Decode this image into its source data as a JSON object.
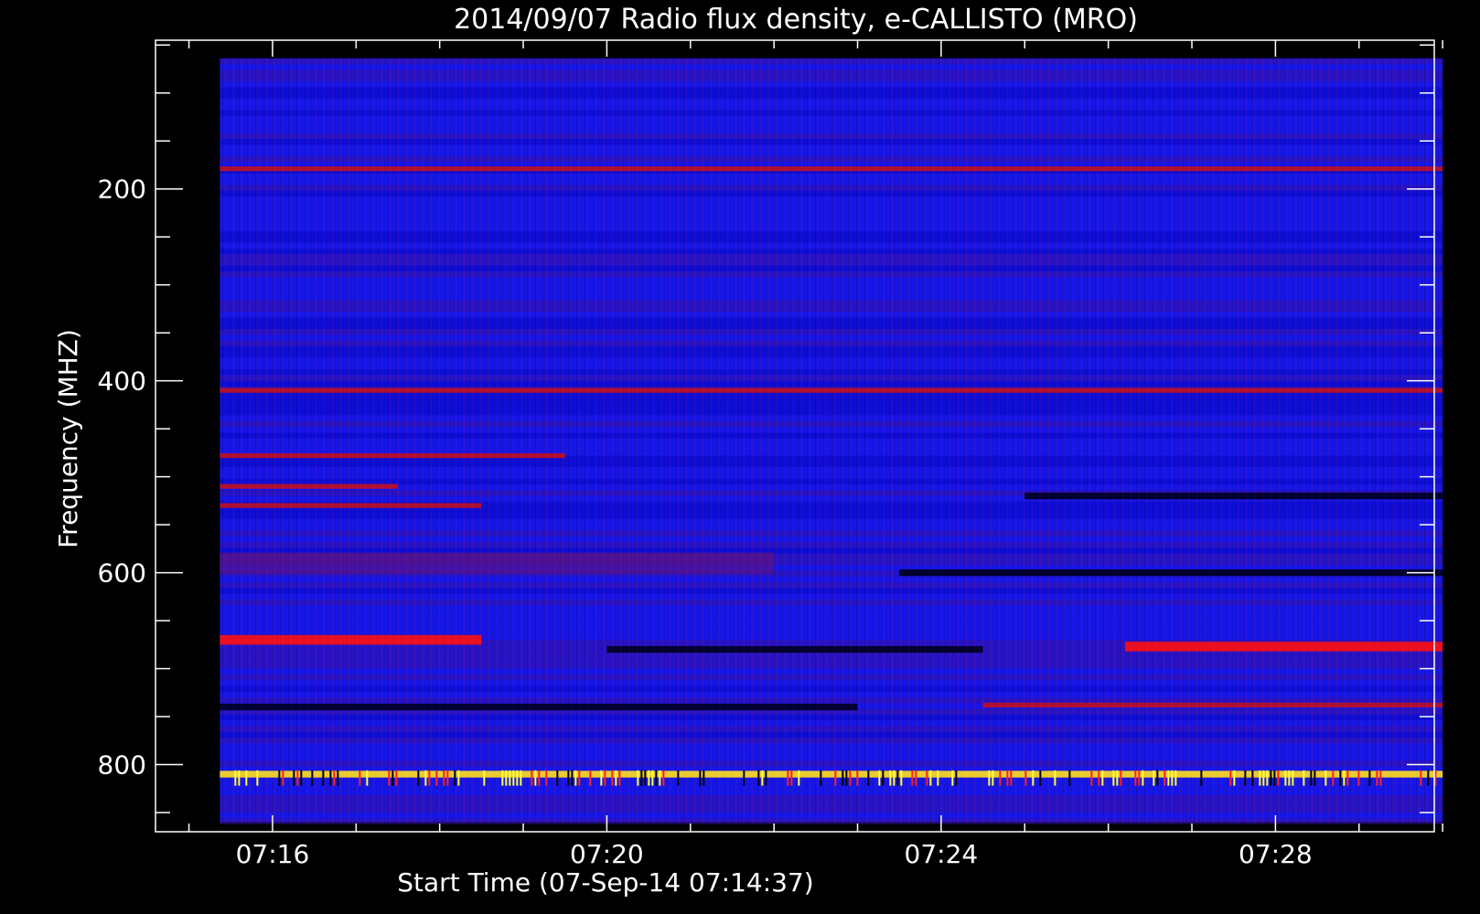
{
  "chart_data": {
    "type": "heatmap",
    "title": "2014/09/07  Radio flux density, e-CALLISTO (MRO)",
    "xlabel": "Start Time (07-Sep-14 07:14:37)",
    "ylabel": "Frequency (MHZ)",
    "x_ticks": [
      "07:16",
      "07:20",
      "07:24",
      "07:28"
    ],
    "x_tick_minutes": [
      16,
      20,
      24,
      28
    ],
    "x_range_minutes": [
      14.6,
      29.9
    ],
    "y_ticks": [
      200,
      400,
      600,
      800
    ],
    "y_range": [
      45,
      870
    ],
    "y_direction": "downward increasing",
    "data_x_range_minutes": [
      15.37,
      30.0
    ],
    "data_y_range": [
      64,
      860
    ],
    "colormap": [
      "#000000",
      "#0000ff",
      "#ff0000",
      "#ffff00"
    ],
    "background_value": "blue",
    "features": [
      {
        "freq": 179,
        "t_start": 15.37,
        "t_end": 30.0,
        "level": "red"
      },
      {
        "freq": 410,
        "t_start": 15.37,
        "t_end": 30.0,
        "level": "red"
      },
      {
        "freq": 478,
        "t_start": 15.37,
        "t_end": 19.5,
        "level": "red"
      },
      {
        "freq": 510,
        "t_start": 15.37,
        "t_end": 17.5,
        "level": "red"
      },
      {
        "freq": 530,
        "t_start": 15.37,
        "t_end": 18.5,
        "level": "red"
      },
      {
        "freq": 590,
        "t_start": 15.37,
        "t_end": 22.0,
        "level": "dark-red"
      },
      {
        "freq": 670,
        "t_start": 15.37,
        "t_end": 18.5,
        "level": "bright-red"
      },
      {
        "freq": 677,
        "t_start": 26.2,
        "t_end": 30.0,
        "level": "bright-red"
      },
      {
        "freq": 680,
        "t_start": 20.0,
        "t_end": 24.5,
        "level": "black"
      },
      {
        "freq": 740,
        "t_start": 15.37,
        "t_end": 23.0,
        "level": "black"
      },
      {
        "freq": 738,
        "t_start": 24.5,
        "t_end": 30.0,
        "level": "red"
      },
      {
        "freq": 600,
        "t_start": 23.5,
        "t_end": 30.0,
        "level": "black"
      },
      {
        "freq": 520,
        "t_start": 25.0,
        "t_end": 30.0,
        "level": "black"
      },
      {
        "freq": 810,
        "t_start": 15.37,
        "t_end": 30.0,
        "level": "yellow"
      }
    ]
  }
}
